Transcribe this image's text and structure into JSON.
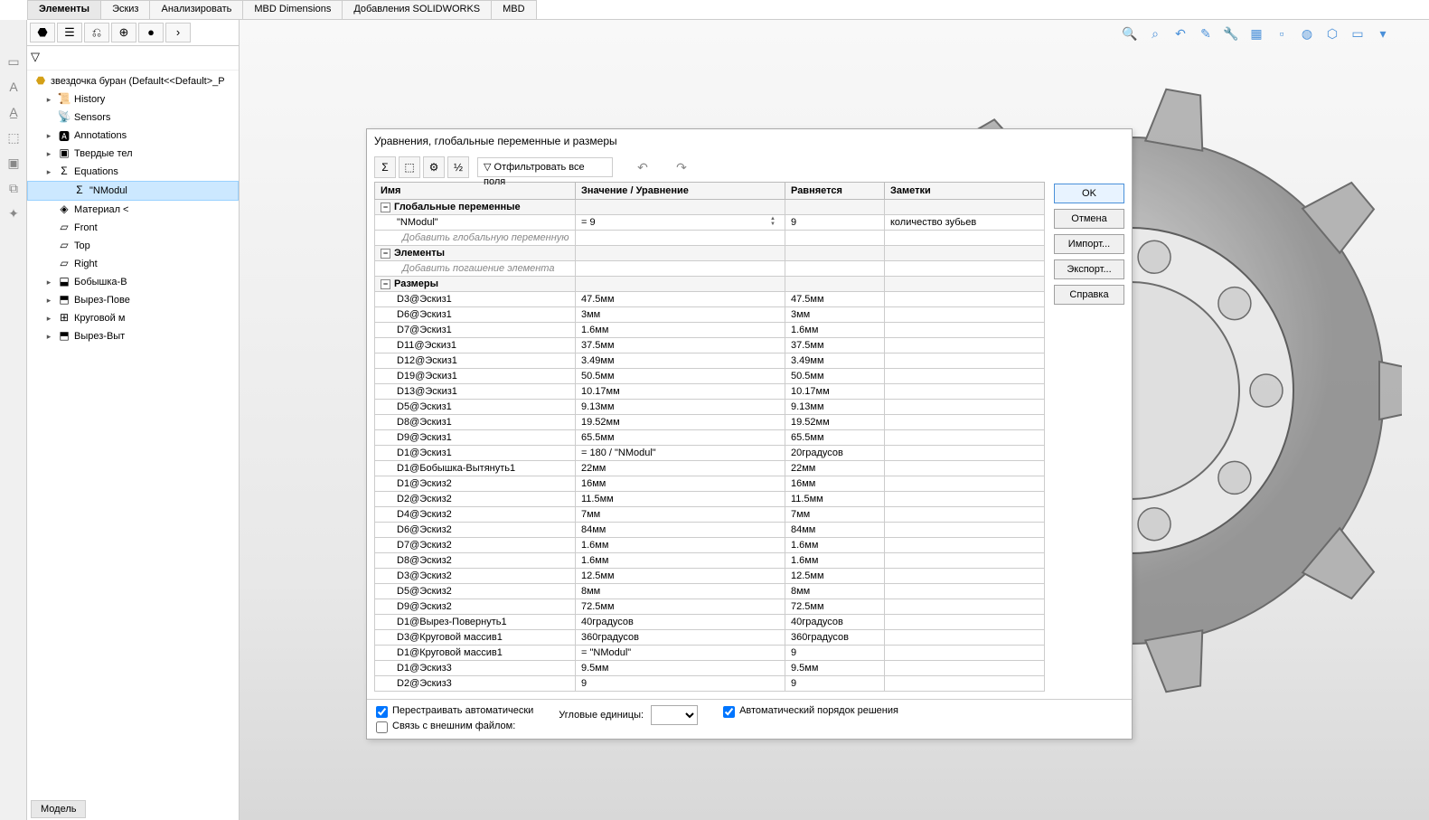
{
  "tabs": [
    "Элементы",
    "Эскиз",
    "Анализировать",
    "MBD Dimensions",
    "Добавления SOLIDWORKS",
    "MBD"
  ],
  "tree": {
    "root": "звездочка буран  (Default<<Default>_P",
    "items": [
      {
        "label": "History",
        "pl": 1
      },
      {
        "label": "Sensors",
        "pl": 1
      },
      {
        "label": "Annotations",
        "pl": 1
      },
      {
        "label": "Твердые тел",
        "pl": 1
      },
      {
        "label": "Equations",
        "pl": 1
      },
      {
        "label": "\"NModul",
        "pl": 2,
        "selected": true
      },
      {
        "label": "Материал <",
        "pl": 1
      },
      {
        "label": "Front",
        "pl": 1
      },
      {
        "label": "Top",
        "pl": 1
      },
      {
        "label": "Right",
        "pl": 1
      },
      {
        "label": "Бобышка-В",
        "pl": 1
      },
      {
        "label": "Вырез-Пове",
        "pl": 1
      },
      {
        "label": "Круговой м",
        "pl": 1
      },
      {
        "label": "Вырез-Выт",
        "pl": 1
      }
    ]
  },
  "dialog": {
    "title": "Уравнения, глобальные переменные и размеры",
    "filter_label": "Отфильтровать все поля",
    "headers": [
      "Имя",
      "Значение / Уравнение",
      "Равняется",
      "Заметки"
    ],
    "section_globals": "Глобальные переменные",
    "hint_globals": "Добавить глобальную переменную",
    "section_features": "Элементы",
    "hint_features": "Добавить погашение элемента",
    "section_dims": "Размеры",
    "globals": [
      {
        "name": "\"NModul\"",
        "value": "= 9",
        "equals": "9",
        "notes": "количество зубьев",
        "active": true
      }
    ],
    "dims": [
      {
        "name": "D3@Эскиз1",
        "value": "47.5мм",
        "equals": "47.5мм"
      },
      {
        "name": "D6@Эскиз1",
        "value": "3мм",
        "equals": "3мм"
      },
      {
        "name": "D7@Эскиз1",
        "value": "1.6мм",
        "equals": "1.6мм"
      },
      {
        "name": "D11@Эскиз1",
        "value": "37.5мм",
        "equals": "37.5мм"
      },
      {
        "name": "D12@Эскиз1",
        "value": "3.49мм",
        "equals": "3.49мм"
      },
      {
        "name": "D19@Эскиз1",
        "value": "50.5мм",
        "equals": "50.5мм"
      },
      {
        "name": "D13@Эскиз1",
        "value": "10.17мм",
        "equals": "10.17мм"
      },
      {
        "name": "D5@Эскиз1",
        "value": "9.13мм",
        "equals": "9.13мм"
      },
      {
        "name": "D8@Эскиз1",
        "value": "19.52мм",
        "equals": "19.52мм"
      },
      {
        "name": "D9@Эскиз1",
        "value": "65.5мм",
        "equals": "65.5мм"
      },
      {
        "name": "D1@Эскиз1",
        "value": "= 180 / \"NModul\"",
        "equals": "20градусов"
      },
      {
        "name": "D1@Бобышка-Вытянуть1",
        "value": "22мм",
        "equals": "22мм"
      },
      {
        "name": "D1@Эскиз2",
        "value": "16мм",
        "equals": "16мм"
      },
      {
        "name": "D2@Эскиз2",
        "value": "11.5мм",
        "equals": "11.5мм"
      },
      {
        "name": "D4@Эскиз2",
        "value": "7мм",
        "equals": "7мм"
      },
      {
        "name": "D6@Эскиз2",
        "value": "84мм",
        "equals": "84мм"
      },
      {
        "name": "D7@Эскиз2",
        "value": "1.6мм",
        "equals": "1.6мм"
      },
      {
        "name": "D8@Эскиз2",
        "value": "1.6мм",
        "equals": "1.6мм"
      },
      {
        "name": "D3@Эскиз2",
        "value": "12.5мм",
        "equals": "12.5мм"
      },
      {
        "name": "D5@Эскиз2",
        "value": "8мм",
        "equals": "8мм"
      },
      {
        "name": "D9@Эскиз2",
        "value": "72.5мм",
        "equals": "72.5мм"
      },
      {
        "name": "D1@Вырез-Повернуть1",
        "value": "40градусов",
        "equals": "40градусов"
      },
      {
        "name": "D3@Круговой массив1",
        "value": "360градусов",
        "equals": "360градусов"
      },
      {
        "name": "D1@Круговой массив1",
        "value": "= \"NModul\"",
        "equals": "9"
      },
      {
        "name": "D1@Эскиз3",
        "value": "9.5мм",
        "equals": "9.5мм"
      },
      {
        "name": "D2@Эскиз3",
        "value": "9",
        "equals": "9"
      }
    ],
    "buttons": {
      "ok": "OK",
      "cancel": "Отмена",
      "import": "Импорт...",
      "export": "Экспорт...",
      "help": "Справка"
    },
    "footer": {
      "rebuild": "Перестраивать автоматически",
      "link": "Связь с внешним файлом:",
      "units_label": "Угловые единицы:",
      "auto_order": "Автоматический порядок решения"
    }
  },
  "bottom_tabs": [
    "Модель"
  ]
}
